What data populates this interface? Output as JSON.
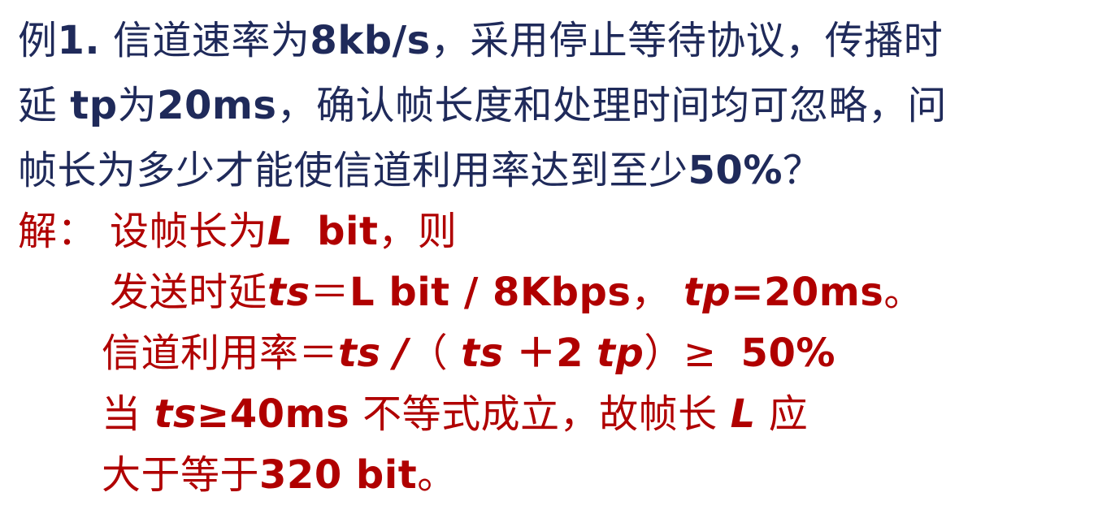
{
  "question": {
    "line1": {
      "a": "例",
      "b": "1.",
      "c": " 信道速率为",
      "d": "8kb/s",
      "e": "，采用停止等待协议，传播时"
    },
    "line2": {
      "a": "延 ",
      "b": "tp",
      "c": "为",
      "d": "20ms",
      "e": "，确认帧长度和处理时间均可忽略，问"
    },
    "line3": {
      "a": "帧长为多少才能使信道利用率达到至少",
      "b": "50%",
      "c": "？"
    }
  },
  "answer": {
    "line1": {
      "a": "解：",
      "b": "设帧长为",
      "c": "L",
      "d": "bit",
      "e": "，则"
    },
    "line2": {
      "a": "发送时延",
      "b": "ts",
      "c": "＝",
      "d": "L bit / 8Kbps",
      "e": "，",
      "f": "tp",
      "g": "=20ms",
      "h": "。"
    },
    "line3": {
      "a": "信道利用率＝",
      "b": "ts",
      "c": "/",
      "d": "（",
      "e": "ts",
      "f": "＋2",
      "g": "tp",
      "h": "）≥",
      "i": "50%"
    },
    "line4": {
      "a": "当",
      "b": "ts",
      "c": "≥40ms",
      "d": "不等式成立，故帧长",
      "e": "L",
      "f": "应"
    },
    "line5": {
      "a": "大于等于",
      "b": "320 bit",
      "c": "。"
    }
  },
  "colors": {
    "question_text": "#1f2a5a",
    "answer_text": "#b00000",
    "background": "#ffffff"
  }
}
